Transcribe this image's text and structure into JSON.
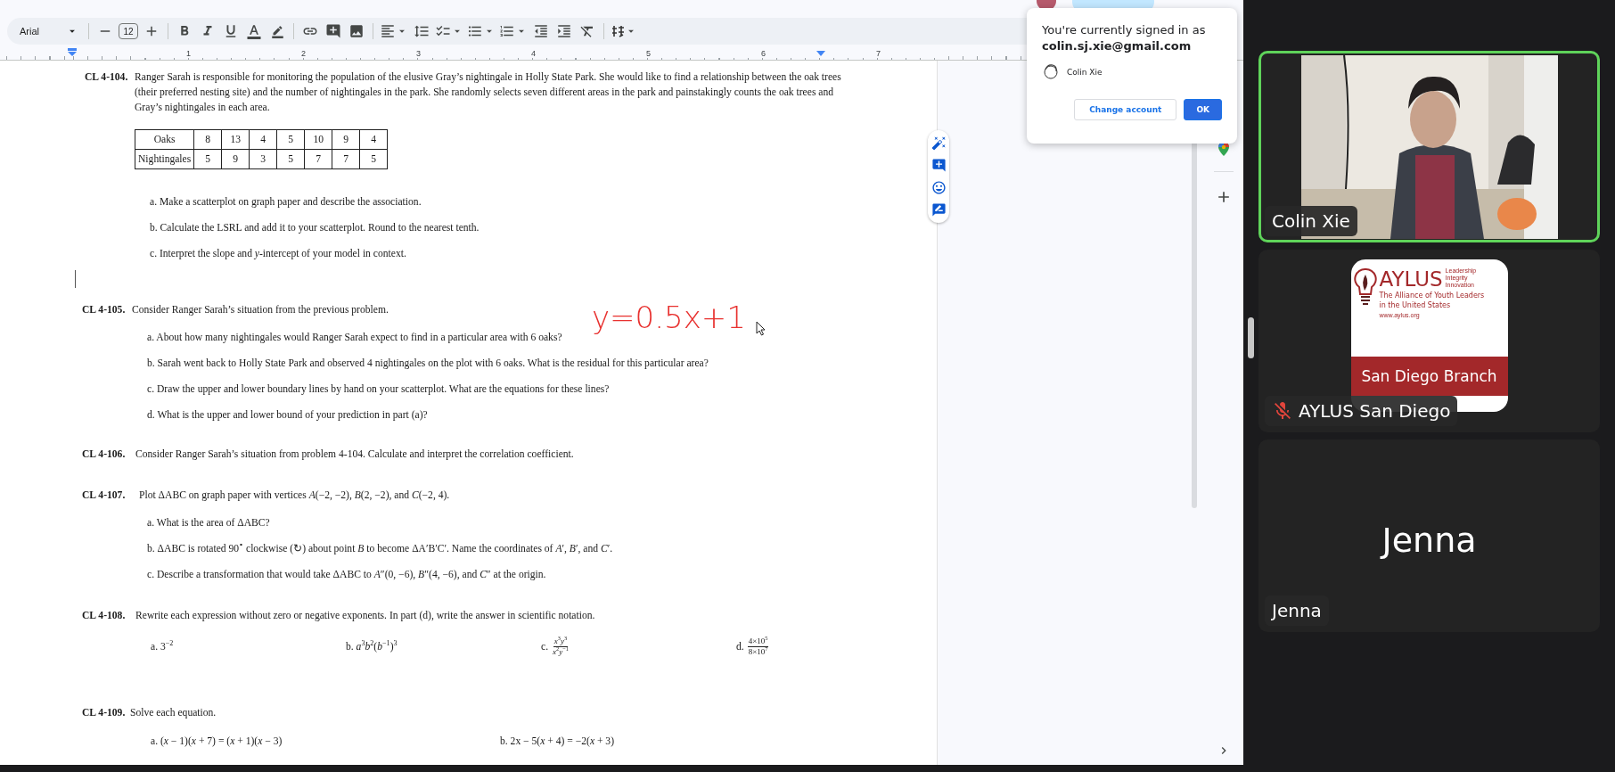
{
  "toolbar": {
    "font": "Arial",
    "font_size": "12"
  },
  "ruler": {
    "marks": [
      "1",
      "2",
      "3",
      "4",
      "5",
      "6",
      "7"
    ]
  },
  "problems": [
    {
      "number": "CL 4-104.",
      "text": "Ranger Sarah is responsible for monitoring the population of the elusive Gray’s nightingale in Holly State Park. She would like to find a relationship between the oak trees (their preferred nesting site) and the number of nightingales in the park. She randomly selects seven different areas in the park and painstakingly counts the oak trees and Gray’s nightingales in each area.",
      "table": [
        [
          "Oaks",
          "8",
          "13",
          "4",
          "5",
          "10",
          "9",
          "4"
        ],
        [
          "Nightingales",
          "5",
          "9",
          "3",
          "5",
          "7",
          "7",
          "5"
        ]
      ],
      "kind": "stacked",
      "parts": [
        {
          "kind": "text",
          "text": "a. Make a scatterplot on graph paper and describe the association."
        },
        {
          "kind": "text",
          "text": "b. Calculate the LSRL and add it to your scatterplot. Round to the nearest tenth."
        },
        {
          "kind": "text",
          "text": "c. Interpret the slope and *y*-intercept of your model in context."
        }
      ]
    },
    {
      "number": "CL 4-105.",
      "text": "Consider Ranger Sarah’s situation from the previous problem.",
      "kind": "stacked",
      "parts": [
        {
          "kind": "text",
          "text": "a. About how many nightingales would Ranger Sarah expect to find in a particular area with 6 oaks?"
        },
        {
          "kind": "text",
          "text": "b. Sarah went back to Holly State Park and observed 4 nightingales on the plot with 6 oaks. What is the residual for this particular area?"
        },
        {
          "kind": "text",
          "text": "c. Draw the upper and lower boundary lines by hand on your scatterplot. What are the equations for these lines?"
        },
        {
          "kind": "text",
          "text": "d. What is the upper and lower bound of your prediction in part (a)?"
        }
      ]
    },
    {
      "number": "CL 4-106.",
      "text": "Consider Ranger Sarah’s situation from problem 4-104. Calculate and interpret the correlation coefficient.",
      "kind": "stacked"
    },
    {
      "number": "CL 4-107.",
      "text": "Plot ΔABC on graph paper with vertices *A*(−2, −2), *B*(2, −2), and *C*(−2, 4).",
      "kind": "stacked",
      "parts": [
        {
          "kind": "text",
          "text": "a. What is the area of ΔABC?"
        },
        {
          "kind": "text",
          "text": "b. ΔABC is rotated 90$^{∘}$ clockwise (↻) about point *B* to become ΔA′B′C′. Name the coordinates of *A*′, *B*′, and *C*′."
        },
        {
          "kind": "text",
          "text": "c. Describe a transformation that would take ΔABC to *A*″(0, −6), *B*″(4, −6), and *C*″ at the origin."
        }
      ]
    },
    {
      "number": "CL 4-108.",
      "text": "Rewrite each expression without zero or negative exponents. In part (d), write the answer in scientific notation.",
      "kind": "inline",
      "parts": [
        {
          "kind": "text",
          "text": "a. 3$^{−2}$"
        },
        {
          "kind": "text",
          "text": "b. *a*$^{3}$*b*$^{2}$(*b*$^{−1}$)$^{3}$"
        },
        {
          "kind": "fraction",
          "label": "c.",
          "numerator": "*x*$^{3}$*y*$^{3}$",
          "denominator": "*x*$^{2}$*y*$^{−1}$"
        },
        {
          "kind": "fraction",
          "label": "d.",
          "numerator": "4×10$^{5}$",
          "denominator": "8×10$^{7}$"
        }
      ]
    },
    {
      "number": "CL 4-109.",
      "text": "Solve each equation.",
      "kind": "inline",
      "parts": [
        {
          "kind": "text",
          "text": "a. (*x* − 1)(*x* + 7) = (*x* + 1)(*x* − 3)"
        },
        {
          "kind": "text",
          "text": "b. 2x − 5(*x* + 4) = −2(*x* + 3)"
        }
      ]
    }
  ],
  "annotation": {
    "text": "y=0.5x+1"
  },
  "dialog": {
    "message": "You're currently signed in as",
    "email": "colin.sj.xie@gmail.com",
    "account": "Colin Xie",
    "buttons": [
      {
        "label": "Change account",
        "primary": false
      },
      {
        "label": "OK",
        "primary": true
      }
    ]
  },
  "meet": {
    "tiles": [
      {
        "kind": "video",
        "name": "Colin Xie",
        "speaking": true,
        "muted": false
      },
      {
        "kind": "logo",
        "name": "AYLUS San Diego",
        "speaking": false,
        "muted": true,
        "logo": {
          "title": "AYLUS",
          "values": [
            "Leadership",
            "Integrity",
            "Innovation"
          ],
          "lines": [
            "The Alliance of Youth Leaders",
            "in the United States"
          ],
          "url": "www.aylus.org",
          "branch": "San Diego Branch"
        }
      },
      {
        "kind": "initials",
        "name": "Jenna",
        "display": "Jenna",
        "speaking": false,
        "muted": false
      }
    ]
  }
}
